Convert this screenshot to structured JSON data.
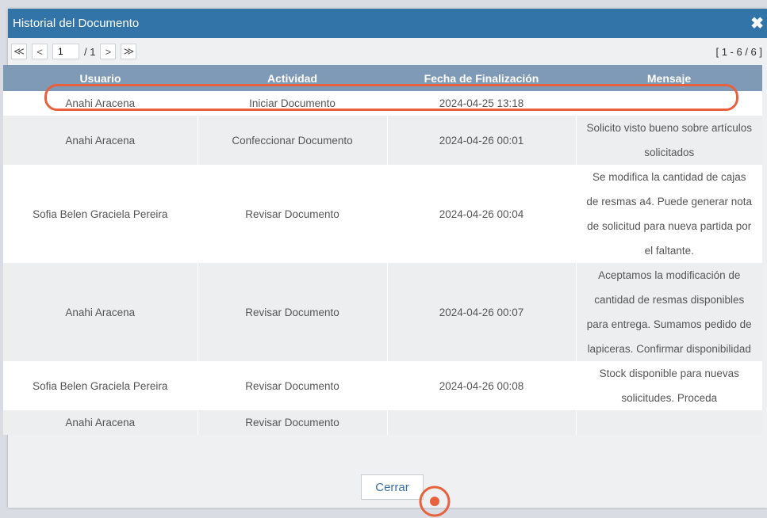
{
  "dialog": {
    "title": "Historial del Documento"
  },
  "pager": {
    "first": "≪",
    "prev": "<",
    "page_value": "1",
    "total": "/ 1",
    "next": ">",
    "last": "≫",
    "range": "[ 1 - 6 / 6 ]"
  },
  "table": {
    "headers": [
      "Usuario",
      "Actividad",
      "Fecha de Finalización",
      "Mensaje"
    ],
    "rows": [
      {
        "usuario": "Anahi Aracena",
        "actividad": "Iniciar Documento",
        "fecha": "2024-04-25 13:18",
        "mensaje": []
      },
      {
        "usuario": "Anahi Aracena",
        "actividad": "Confeccionar Documento",
        "fecha": "2024-04-26 00:01",
        "mensaje": [
          "Solicito visto bueno sobre artículos",
          "solicitados"
        ]
      },
      {
        "usuario": "Sofia Belen Graciela Pereira",
        "actividad": "Revisar Documento",
        "fecha": "2024-04-26 00:04",
        "mensaje": [
          "Se modifica la cantidad de cajas",
          "de resmas a4. Puede generar nota",
          "de solicitud para nueva partida por",
          "el faltante."
        ]
      },
      {
        "usuario": "Anahi Aracena",
        "actividad": "Revisar Documento",
        "fecha": "2024-04-26 00:07",
        "mensaje": [
          "Aceptamos la modificación de",
          "cantidad de resmas disponibles",
          "para entrega. Sumamos pedido de",
          "lapiceras. Confirmar disponibilidad"
        ]
      },
      {
        "usuario": "Sofia Belen Graciela Pereira",
        "actividad": "Revisar Documento",
        "fecha": "2024-04-26 00:08",
        "mensaje": [
          "Stock disponible para nuevas",
          "solicitudes. Proceda"
        ]
      },
      {
        "usuario": "Anahi Aracena",
        "actividad": "Revisar Documento",
        "fecha": "",
        "mensaje": []
      }
    ]
  },
  "footer": {
    "close_label": "Cerrar"
  },
  "colors": {
    "titlebar": "#3273a8",
    "header": "#7f9ab6",
    "highlight": "#e8603c",
    "link": "#3a6ea5"
  }
}
